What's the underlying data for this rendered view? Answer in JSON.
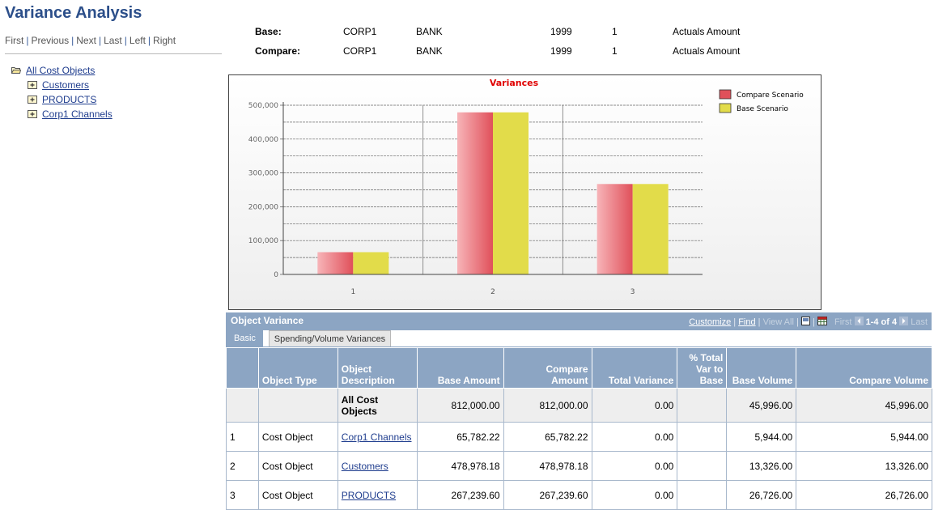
{
  "page": {
    "title": "Variance Analysis",
    "nav": [
      "First",
      "Previous",
      "Next",
      "Last",
      "Left",
      "Right"
    ]
  },
  "tree": {
    "root": "All Cost Objects",
    "children": [
      "Customers",
      "PRODUCTS",
      "Corp1 Channels"
    ]
  },
  "header": {
    "base": {
      "label": "Base:",
      "v1": "CORP1",
      "v2": "BANK",
      "year": "1999",
      "period": "1",
      "amount": "Actuals Amount"
    },
    "compare": {
      "label": "Compare:",
      "v1": "CORP1",
      "v2": "BANK",
      "year": "1999",
      "period": "1",
      "amount": "Actuals Amount"
    }
  },
  "chart_data": {
    "type": "bar",
    "title": "Variances",
    "categories": [
      "1",
      "2",
      "3"
    ],
    "series": [
      {
        "name": "Compare Scenario",
        "values": [
          65782.22,
          478978.18,
          267239.6
        ],
        "color": "#e0505a"
      },
      {
        "name": "Base Scenario",
        "values": [
          65782.22,
          478978.18,
          267239.6
        ],
        "color": "#e2dc4a"
      }
    ],
    "y_ticks": [
      "0",
      "100,000",
      "200,000",
      "300,000",
      "400,000",
      "500,000"
    ],
    "ylim": [
      0,
      500000
    ],
    "grid": true,
    "legend": "top-right",
    "title_color": "#e00000"
  },
  "grid": {
    "title": "Object Variance",
    "tools": {
      "customize": "Customize",
      "find": "Find",
      "view_all": "View All",
      "first": "First",
      "range": "1-4 of 4",
      "last": "Last"
    },
    "tabs": [
      "Basic",
      "Spending/Volume Variances"
    ],
    "columns": [
      "",
      "Object Type",
      "Object Description",
      "Base Amount",
      "Compare Amount",
      "Total Variance",
      "% Total Var to Base",
      "Base Volume",
      "Compare Volume"
    ],
    "rows": [
      {
        "num": "",
        "type": "",
        "desc": "All Cost Objects",
        "base_amt": "812,000.00",
        "cmp_amt": "812,000.00",
        "total_var": "0.00",
        "pct": "",
        "base_vol": "45,996.00",
        "cmp_vol": "45,996.00"
      },
      {
        "num": "1",
        "type": "Cost Object",
        "desc": "Corp1 Channels",
        "base_amt": "65,782.22",
        "cmp_amt": "65,782.22",
        "total_var": "0.00",
        "pct": "",
        "base_vol": "5,944.00",
        "cmp_vol": "5,944.00"
      },
      {
        "num": "2",
        "type": "Cost Object",
        "desc": "Customers",
        "base_amt": "478,978.18",
        "cmp_amt": "478,978.18",
        "total_var": "0.00",
        "pct": "",
        "base_vol": "13,326.00",
        "cmp_vol": "13,326.00"
      },
      {
        "num": "3",
        "type": "Cost Object",
        "desc": "PRODUCTS",
        "base_amt": "267,239.60",
        "cmp_amt": "267,239.60",
        "total_var": "0.00",
        "pct": "",
        "base_vol": "26,726.00",
        "cmp_vol": "26,726.00"
      }
    ]
  }
}
